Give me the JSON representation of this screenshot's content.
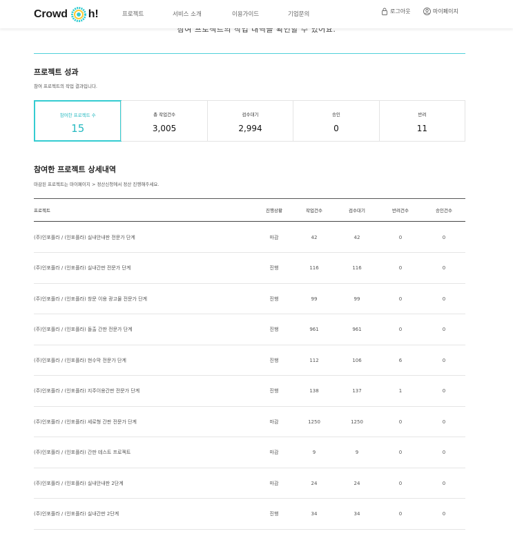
{
  "header": {
    "logo_left": "Crowd",
    "logo_right": "h!",
    "nav": [
      "프로젝트",
      "서비스 소개",
      "이용가이드",
      "기업문의"
    ],
    "login": "로그아웃",
    "mypage": "마이페이지",
    "accent": "#33ccd1"
  },
  "intro": {
    "obscured_text": "참여 프로젝트의 작업 내역을 확인할 수 있어요."
  },
  "performance": {
    "title": "프로젝트 성과",
    "desc": "참여 프로젝트의 작업 결과입니다.",
    "stats": [
      {
        "label": "참여한 프로젝트 수",
        "value": "15"
      },
      {
        "label": "총 작업건수",
        "value": "3,005"
      },
      {
        "label": "검수대기",
        "value": "2,994"
      },
      {
        "label": "승인",
        "value": "0"
      },
      {
        "label": "반려",
        "value": "11"
      }
    ]
  },
  "details": {
    "title": "참여한 프로젝트 상세내역",
    "desc": "마감된 프로젝트는 마이페이지 > 정산신청에서 정산 진행해주세요.",
    "columns": [
      "프로젝트",
      "진행상황",
      "작업건수",
      "검수대기",
      "반려건수",
      "승인건수"
    ],
    "rows": [
      [
        "(주)인포플라 / (인포플라) 실내안내판 전문가 단계",
        "마감",
        "42",
        "42",
        "0",
        "0"
      ],
      [
        "(주)인포플라 / (인포플라) 실내간판 전문가 단계",
        "진행",
        "116",
        "116",
        "0",
        "0"
      ],
      [
        "(주)인포플라 / (인포플라) 창문 이용 광고물 전문가 단계",
        "진행",
        "99",
        "99",
        "0",
        "0"
      ],
      [
        "(주)인포플라 / (인포플라) 돌출 간판 전문가 단계",
        "진행",
        "961",
        "961",
        "0",
        "0"
      ],
      [
        "(주)인포플라 / (인포플라) 현수막 전문가 단계",
        "진행",
        "112",
        "106",
        "6",
        "0"
      ],
      [
        "(주)인포플라 / (인포플라) 지주이용간판 전문가 단계",
        "진행",
        "138",
        "137",
        "1",
        "0"
      ],
      [
        "(주)인포플라 / (인포플라) 세로형 간판 전문가 단계",
        "마감",
        "1250",
        "1250",
        "0",
        "0"
      ],
      [
        "(주)인포플라 / (인포플라) 간판 테스트 프로젝트",
        "마감",
        "9",
        "9",
        "0",
        "0"
      ],
      [
        "(주)인포플라 / (인포플라) 실내안내판 2단계",
        "마감",
        "24",
        "24",
        "0",
        "0"
      ],
      [
        "(주)인포플라 / (인포플라) 실내간판 2단계",
        "진행",
        "34",
        "34",
        "0",
        "0"
      ]
    ]
  }
}
